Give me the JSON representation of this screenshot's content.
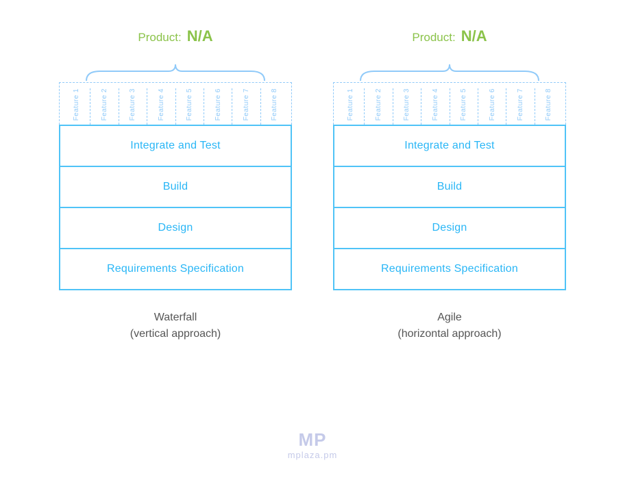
{
  "diagrams": [
    {
      "product_label": "Product:",
      "product_value": "N/A",
      "features": [
        "Feature 1",
        "Feature 2",
        "Feature 3",
        "Feature 4",
        "Feature 5",
        "Feature 6",
        "Feature 7",
        "Feature 8"
      ],
      "phases": [
        "Integrate and Test",
        "Build",
        "Design",
        "Requirements Specification"
      ],
      "bottom_line1": "Waterfall",
      "bottom_line2": "(vertical approach)"
    },
    {
      "product_label": "Product:",
      "product_value": "N/A",
      "features": [
        "Feature 1",
        "Feature 2",
        "Feature 3",
        "Feature 4",
        "Feature 5",
        "Feature 6",
        "Feature 7",
        "Feature 8"
      ],
      "phases": [
        "Integrate and Test",
        "Build",
        "Design",
        "Requirements Specification"
      ],
      "bottom_line1": "Agile",
      "bottom_line2": "(horizontal approach)"
    }
  ],
  "watermark": {
    "icon": "MP",
    "text": "mplaza.pm"
  }
}
